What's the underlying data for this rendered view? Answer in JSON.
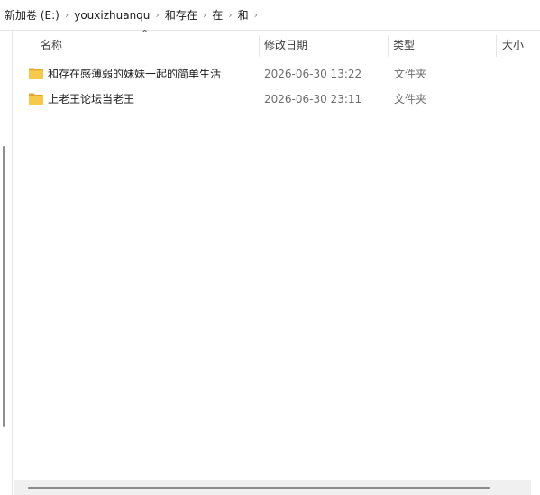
{
  "breadcrumb": [
    "新加卷 (E:)",
    "youxizhuanqu",
    "和存在",
    "在",
    "和"
  ],
  "columns": {
    "name": "名称",
    "date": "修改日期",
    "type": "类型",
    "size": "大小"
  },
  "sort": {
    "column": "name",
    "direction": "ascending"
  },
  "files": [
    {
      "name": "和存在感薄弱的妹妹一起的简单生活",
      "date": "2026-06-30 13:22",
      "type": "文件夹",
      "icon": "folder-icon"
    },
    {
      "name": "上老王论坛当老王",
      "date": "2026-06-30 23:11",
      "type": "文件夹",
      "icon": "folder-icon"
    }
  ],
  "colors": {
    "folder": "#f7c948",
    "folder_dark": "#e2a72e"
  }
}
